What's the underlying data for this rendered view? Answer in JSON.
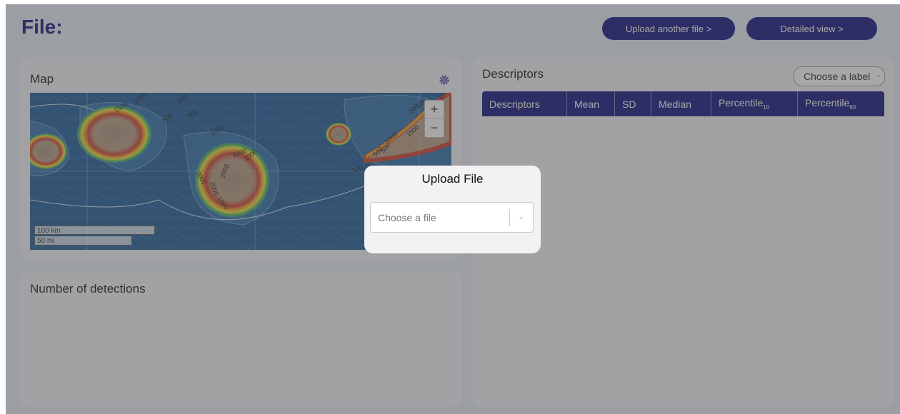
{
  "header": {
    "title": "File:",
    "upload_another_label": "Upload another file >",
    "detailed_view_label": "Detailed view >"
  },
  "map_card": {
    "title": "Map",
    "gear_icon": "gear-icon",
    "zoom_in": "+",
    "zoom_out": "−",
    "scale_km": "100 km",
    "scale_mi": "50 mi",
    "contour_labels": [
      "1500",
      "2000",
      "500",
      "500",
      "500",
      "1500",
      "3000",
      "2000",
      "2000",
      "1000",
      "1500",
      "1000",
      "500",
      "500",
      "1000",
      "500",
      "1500",
      "200",
      "500",
      "1000"
    ]
  },
  "detections_card": {
    "title": "Number of detections"
  },
  "descriptors_card": {
    "title": "Descriptors",
    "label_select_value": "Choose a label",
    "columns": [
      {
        "text": "Descriptors",
        "sub": ""
      },
      {
        "text": "Mean",
        "sub": ""
      },
      {
        "text": "SD",
        "sub": ""
      },
      {
        "text": "Median",
        "sub": ""
      },
      {
        "text": "Percentile",
        "sub": "10"
      },
      {
        "text": "Percentile",
        "sub": "90"
      }
    ]
  },
  "modal": {
    "title": "Upload File",
    "file_select_placeholder": "Choose a file"
  },
  "colors": {
    "brand_navy": "#0c0c7c",
    "card_bg": "#f4f5f8",
    "overlay": "rgba(80,80,80,0.5)"
  }
}
